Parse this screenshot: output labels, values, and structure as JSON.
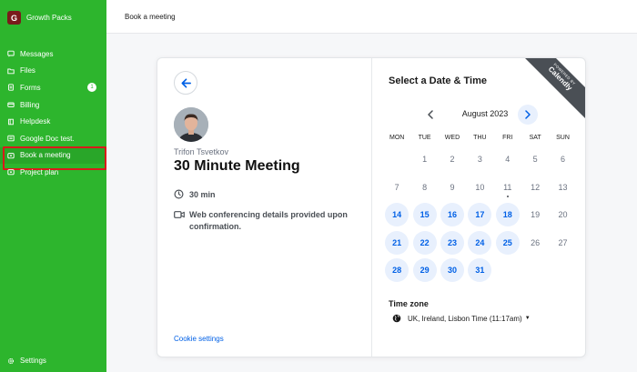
{
  "brand": {
    "logo_letter": "G",
    "name": "Growth Packs"
  },
  "sidebar": {
    "items": [
      {
        "label": "Messages",
        "icon": "message-icon"
      },
      {
        "label": "Files",
        "icon": "folder-icon"
      },
      {
        "label": "Forms",
        "icon": "form-icon",
        "badge": "1"
      },
      {
        "label": "Billing",
        "icon": "billing-icon"
      },
      {
        "label": "Helpdesk",
        "icon": "book-icon"
      },
      {
        "label": "Google Doc test.",
        "icon": "doc-icon"
      },
      {
        "label": "Book a meeting",
        "icon": "meeting-icon",
        "active": true
      },
      {
        "label": "Project plan",
        "icon": "plan-icon"
      }
    ],
    "settings_label": "Settings"
  },
  "header": {
    "title": "Book a meeting"
  },
  "event": {
    "host": "Trifon Tsvetkov",
    "title": "30 Minute Meeting",
    "duration": "30 min",
    "conferencing": "Web conferencing details provided upon confirmation.",
    "cookie_settings": "Cookie settings"
  },
  "calendar": {
    "heading": "Select a Date & Time",
    "ribbon_top": "POWERED BY",
    "ribbon_brand": "Calendly",
    "month": "August 2023",
    "weekdays": [
      "MON",
      "TUE",
      "WED",
      "THU",
      "FRI",
      "SAT",
      "SUN"
    ],
    "weeks": [
      [
        "",
        "1",
        "2",
        "3",
        "4",
        "5",
        "6"
      ],
      [
        "7",
        "8",
        "9",
        "10",
        "11",
        "12",
        "13"
      ],
      [
        "14",
        "15",
        "16",
        "17",
        "18",
        "19",
        "20"
      ],
      [
        "21",
        "22",
        "23",
        "24",
        "25",
        "26",
        "27"
      ],
      [
        "28",
        "29",
        "30",
        "31",
        "",
        "",
        ""
      ]
    ],
    "available_days": [
      "14",
      "15",
      "16",
      "17",
      "18",
      "21",
      "22",
      "23",
      "24",
      "25",
      "28",
      "29",
      "30",
      "31"
    ],
    "today": "11",
    "timezone_label": "Time zone",
    "timezone_value": "UK, Ireland, Lisbon Time (11:17am)"
  },
  "colors": {
    "sidebar": "#2db52d",
    "accent": "#0060e6",
    "highlight": "#d91a1a"
  }
}
